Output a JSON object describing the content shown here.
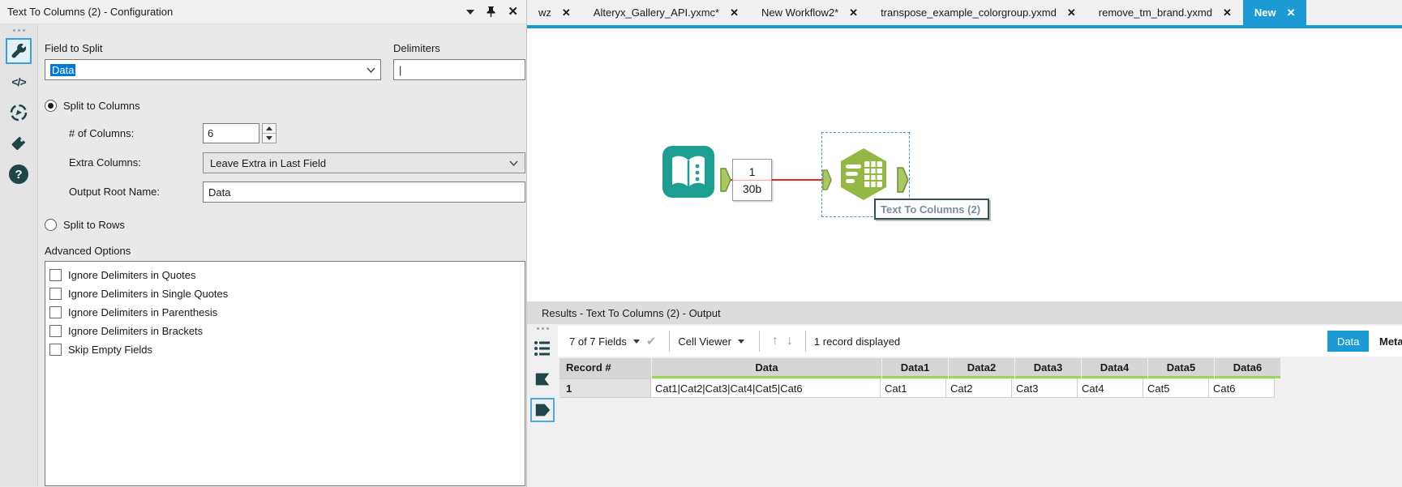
{
  "config": {
    "title": "Text To Columns (2) - Configuration",
    "field_to_split_label": "Field to Split",
    "field_to_split_value": "Data",
    "delimiters_label": "Delimiters",
    "delimiters_value": "|",
    "split_columns_label": "Split to Columns",
    "num_columns_label": "# of Columns:",
    "num_columns_value": "6",
    "extra_columns_label": "Extra Columns:",
    "extra_columns_value": "Leave Extra in Last Field",
    "output_root_label": "Output Root Name:",
    "output_root_value": "Data",
    "split_rows_label": "Split to Rows",
    "advanced_label": "Advanced Options",
    "advanced_items": [
      {
        "label": "Ignore Delimiters in Quotes",
        "checked": false
      },
      {
        "label": "Ignore Delimiters in Single Quotes",
        "checked": false
      },
      {
        "label": "Ignore Delimiters in Parenthesis",
        "checked": false
      },
      {
        "label": "Ignore Delimiters in Brackets",
        "checked": false
      },
      {
        "label": "Skip Empty Fields",
        "checked": false
      }
    ]
  },
  "tabs": [
    {
      "label": "wz",
      "active": false
    },
    {
      "label": "Alteryx_Gallery_API.yxmc*",
      "active": false
    },
    {
      "label": "New Workflow2*",
      "active": false
    },
    {
      "label": "transpose_example_colorgroup.yxmd",
      "active": false
    },
    {
      "label": "remove_tm_brand.yxmd",
      "active": false
    },
    {
      "label": "New",
      "active": true
    }
  ],
  "canvas": {
    "connection_count": "1",
    "connection_size": "30b",
    "tooltip": "Text To Columns (2)"
  },
  "results": {
    "header": "Results - Text To Columns (2) - Output",
    "fields_dropdown": "7 of 7 Fields",
    "cell_viewer": "Cell Viewer",
    "record_info": "1 record displayed",
    "data_button": "Data",
    "metadata_button": "Metadata",
    "table": {
      "headers": [
        "Record #",
        "Data",
        "Data1",
        "Data2",
        "Data3",
        "Data4",
        "Data5",
        "Data6"
      ],
      "rows": [
        [
          "1",
          "Cat1|Cat2|Cat3|Cat4|Cat5|Cat6",
          "Cat1",
          "Cat2",
          "Cat3",
          "Cat4",
          "Cat5",
          "Cat6"
        ]
      ]
    }
  },
  "icons": {
    "close": "✕",
    "check": "✔",
    "arrow_up": "↑",
    "arrow_down": "↓",
    "code": "</>",
    "help": "?"
  },
  "colors": {
    "accent_blue": "#1b9ad6",
    "selection_blue": "#0078d7",
    "tool_green": "#93b944",
    "tool_teal": "#1d9e92",
    "icon_teal": "#1e4649",
    "connection_red": "#f2231a",
    "header_green": "#97d659"
  }
}
